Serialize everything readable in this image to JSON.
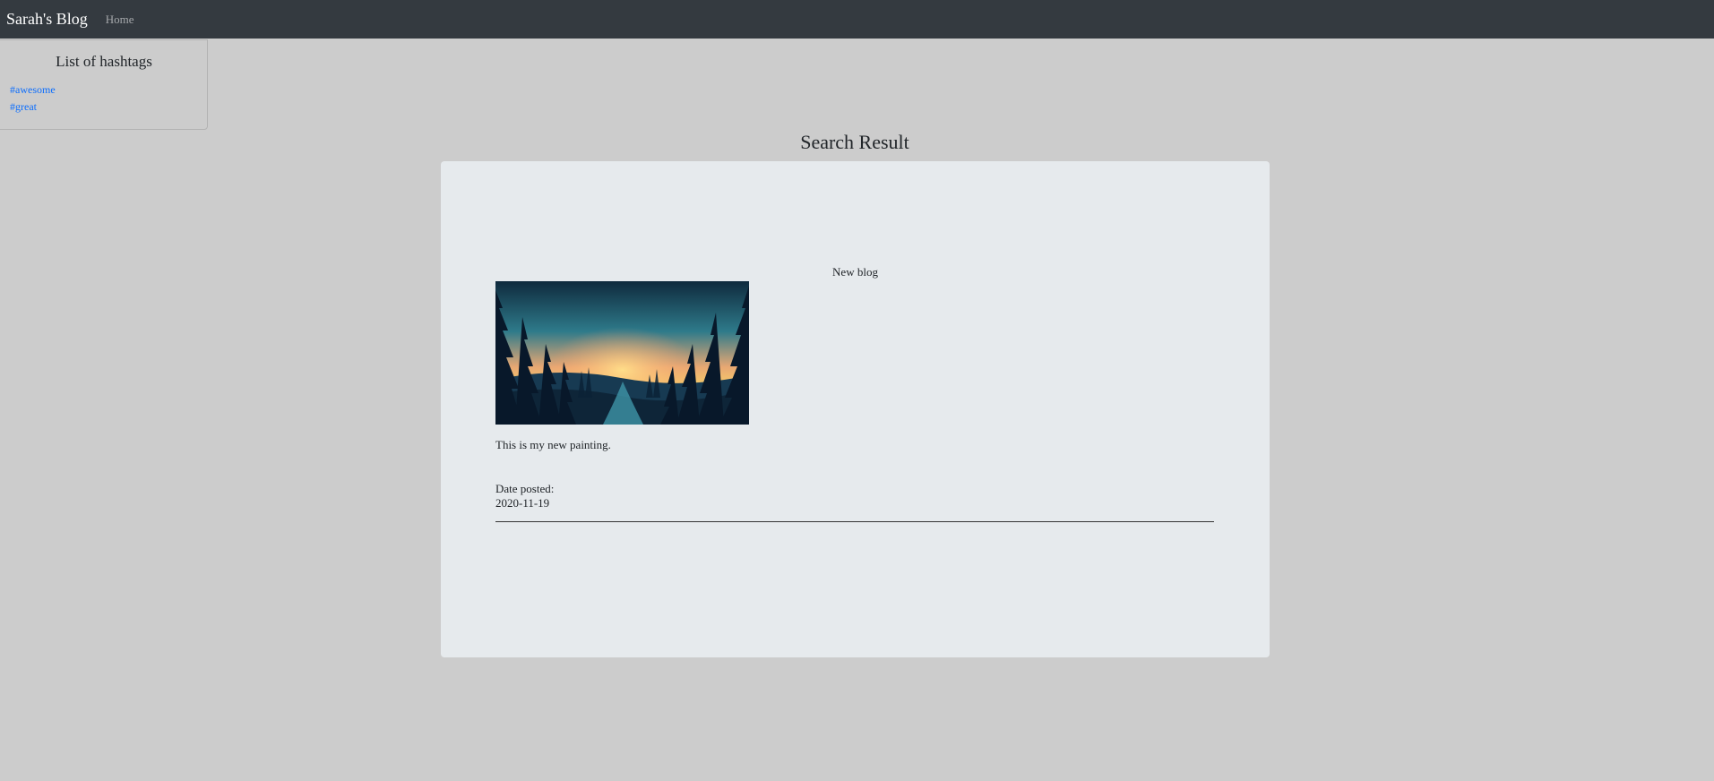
{
  "navbar": {
    "brand": "Sarah's Blog",
    "links": [
      "Home"
    ]
  },
  "hashtags": {
    "title": "List of hashtags",
    "items": [
      "#awesome",
      "#great"
    ]
  },
  "search": {
    "heading": "Search Result"
  },
  "posts": [
    {
      "title": "New blog",
      "image": "forest-sunset-painting",
      "body": "This is my new painting.",
      "date_label": "Date posted:",
      "date": "2020-11-19"
    }
  ],
  "colors": {
    "navbar_bg": "#343a40",
    "page_bg": "#cccccc",
    "card_bg": "#e6eaed",
    "link": "#0d6efd"
  }
}
